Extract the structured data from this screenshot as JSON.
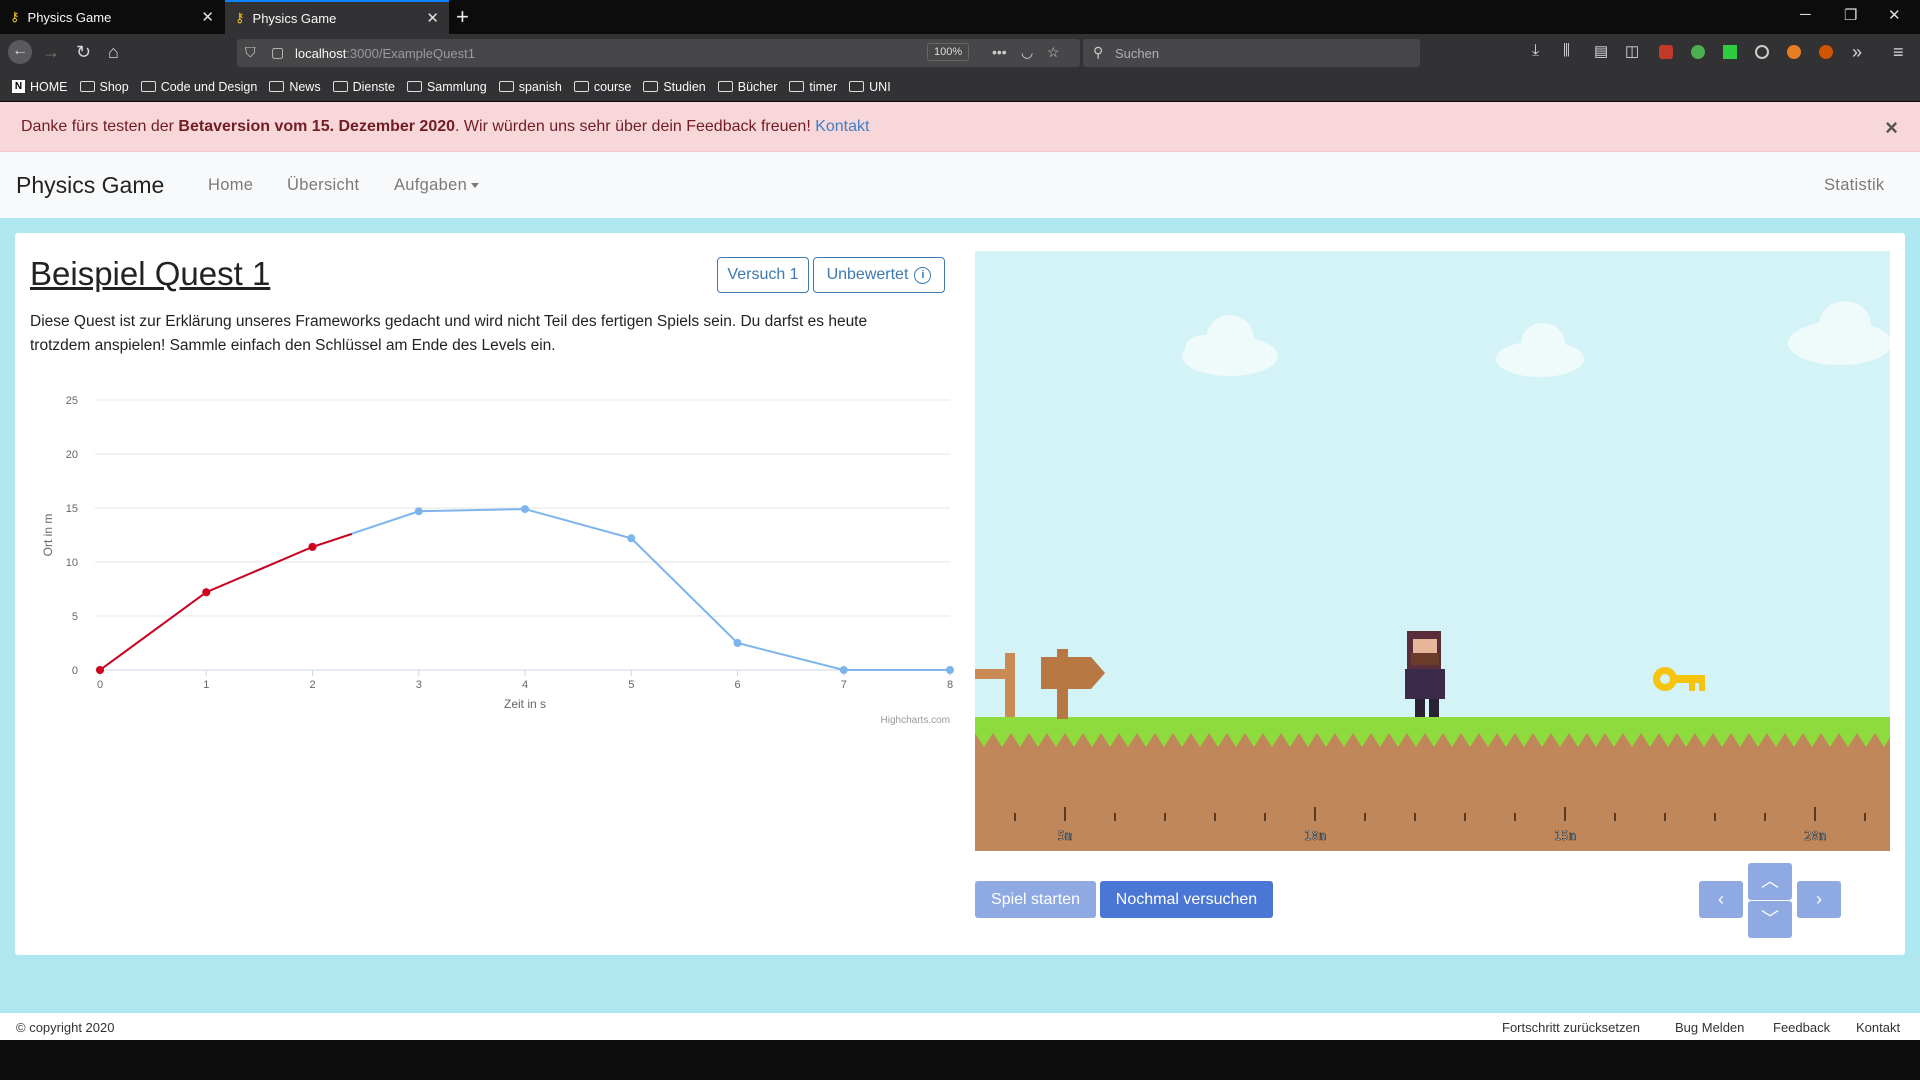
{
  "browser": {
    "tabs": [
      {
        "title": "Physics Game",
        "active": false
      },
      {
        "title": "Physics Game",
        "active": true
      }
    ],
    "url_host": "localhost",
    "url_path": ":3000/ExampleQuest1",
    "zoom": "100%",
    "search_placeholder": "Suchen",
    "bookmarks": [
      "HOME",
      "Shop",
      "Code und Design",
      "News",
      "Dienste",
      "Sammlung",
      "spanish",
      "course",
      "Studien",
      "Bücher",
      "timer",
      "UNI"
    ]
  },
  "alert": {
    "text_before": "Danke fürs testen der ",
    "bold": "Betaversion vom 15. Dezember 2020",
    "text_after": ". Wir würden uns sehr über dein Feedback freuen! ",
    "link": "Kontakt"
  },
  "nav": {
    "brand": "Physics Game",
    "home": "Home",
    "overview": "Übersicht",
    "tasks": "Aufgaben",
    "stats": "Statistik"
  },
  "quest": {
    "title": "Beispiel Quest 1",
    "attempt": "Versuch 1",
    "rating": "Unbewertet",
    "description": "Diese Quest ist zur Erklärung unseres Frameworks gedacht und wird nicht Teil des fertigen Spiels sein. Du darfst es heute trotzdem anspielen! Sammle einfach den Schlüssel am Ende des Levels ein."
  },
  "chart_data": {
    "type": "line",
    "xlabel": "Zeit in s",
    "ylabel": "Ort in m",
    "xlim": [
      0,
      8
    ],
    "ylim": [
      0,
      25
    ],
    "xticks": [
      0,
      1,
      2,
      3,
      4,
      5,
      6,
      7,
      8
    ],
    "yticks": [
      0,
      5,
      10,
      15,
      20,
      25
    ],
    "credits": "Highcharts.com",
    "series": [
      {
        "color": "#7cb5ec",
        "x": [
          0,
          1,
          2,
          3,
          4,
          5,
          6,
          7,
          8
        ],
        "y": [
          0,
          7.2,
          11.4,
          14.7,
          14.9,
          12.2,
          2.5,
          0,
          0
        ]
      },
      {
        "color": "#d0021b",
        "x": [
          0,
          1,
          2,
          2.37
        ],
        "y": [
          0,
          7.2,
          11.4,
          12.6
        ]
      }
    ]
  },
  "game": {
    "ruler_labels": [
      "5m",
      "10m",
      "15m",
      "20m"
    ],
    "sky_color": "#d4f3f6"
  },
  "controls": {
    "start": "Spiel starten",
    "retry": "Nochmal versuchen"
  },
  "footer": {
    "copyright": "© copyright 2020",
    "reset": "Fortschritt zurücksetzen",
    "bug": "Bug Melden",
    "feedback": "Feedback",
    "contact": "Kontakt"
  }
}
